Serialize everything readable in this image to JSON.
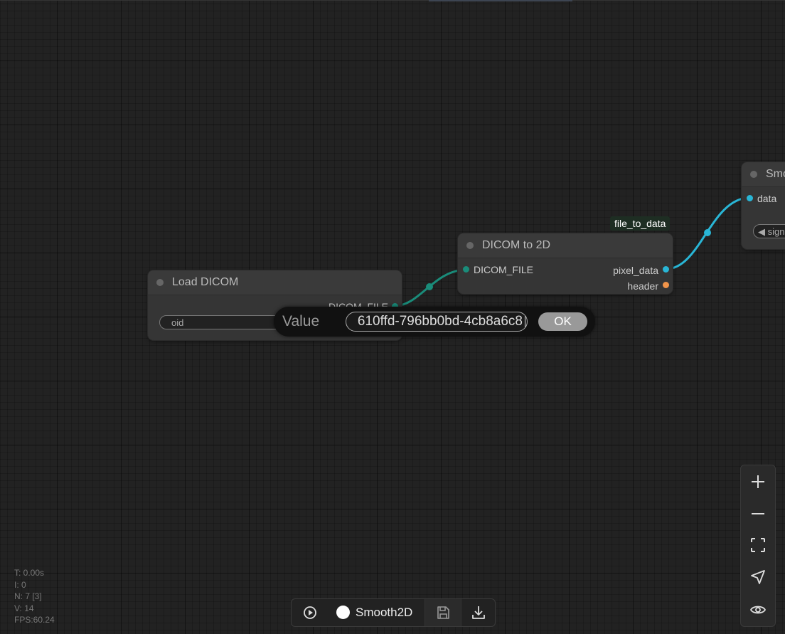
{
  "nodes": {
    "load_dicom": {
      "title": "Load DICOM",
      "output_label": "DICOM_FILE",
      "widget_label": "oid"
    },
    "dicom_to_2d": {
      "title": "DICOM to 2D",
      "badge": "file_to_data",
      "input_label": "DICOM_FILE",
      "outputs": [
        "pixel_data",
        "header"
      ]
    },
    "smooth": {
      "title": "Smo",
      "input_label": "data",
      "widget_label": "◀ sign"
    }
  },
  "prompt": {
    "label": "Value",
    "value": "610ffd-796bb0bd-4cb8a6c8",
    "ok_label": "OK"
  },
  "stats": {
    "t": "T: 0.00s",
    "i": "I: 0",
    "n": "N: 7 [3]",
    "v": "V: 14",
    "fps": "FPS:60.24"
  },
  "bottom_bar": {
    "workflow_name": "Smooth2D"
  },
  "colors": {
    "dicom_link": "#1a8c7a",
    "data_link": "#29b6d6",
    "header_slot": "#f0944a"
  }
}
